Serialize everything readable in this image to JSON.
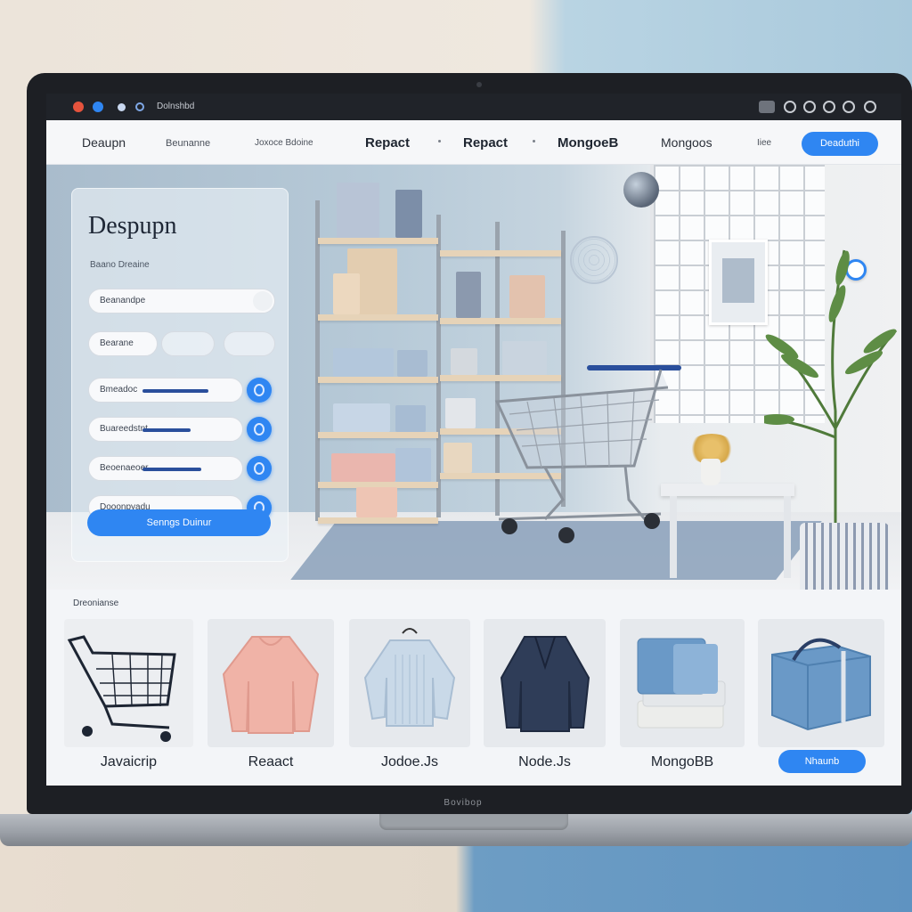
{
  "browser": {
    "url": "Dolnshbd",
    "controls": [
      "close-dot",
      "minimize-dot",
      "maximize-dot"
    ]
  },
  "nav": {
    "brand": "Deaupn",
    "links_small": [
      "Beunanne",
      "Joxoce Bdoine"
    ],
    "links_main": [
      "Repact",
      "Repact",
      "MongoeB",
      "Mongoos"
    ],
    "link_extra": "Iiee",
    "cta": "Deaduthi"
  },
  "login": {
    "title": "Despupn",
    "subtitle": "Baano Dreaine",
    "field1": "Beanandpe",
    "field2": "Bearane",
    "field3": "Bmeadoc",
    "field4": "Buareedstnt",
    "field5": "Beoenaeoer",
    "field6": "Dooonpyadu",
    "submit": "Senngs Duinur"
  },
  "products": {
    "section_label": "Dreonianse",
    "items": [
      {
        "label": "Javaicrip",
        "icon": "shopping-cart-icon"
      },
      {
        "label": "Reaact",
        "icon": "sweater-icon"
      },
      {
        "label": "Jodoe.Js",
        "icon": "knit-sweater-icon"
      },
      {
        "label": "Node.Js",
        "icon": "cardigan-icon"
      },
      {
        "label": "MongoBB",
        "icon": "box-stack-icon"
      }
    ],
    "cta": "Nhaunb",
    "cta_icon": "gift-box-icon"
  },
  "laptop": {
    "chin_label": "Bovibop"
  },
  "colors": {
    "accent": "#2f86f2",
    "dark": "#1d1f24",
    "nav_bg": "#f6f7f9"
  }
}
